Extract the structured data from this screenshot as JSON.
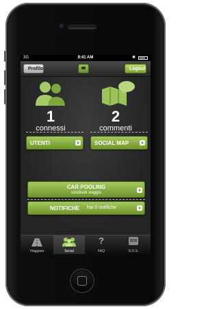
{
  "status_bar": {
    "carrier": "3G",
    "time": "9:41 AM"
  },
  "nav": {
    "left_button": "Profilo",
    "right_button": "Logout"
  },
  "stats": [
    {
      "value": "1",
      "label": "connessi",
      "button": "UTENTI"
    },
    {
      "value": "2",
      "label": "commenti",
      "button": "SOCIAL MAP"
    }
  ],
  "car_pooling": {
    "title": "CAR POOLING",
    "subtitle": "condividi viaggio"
  },
  "notifications": {
    "title": "NOTIFICHE",
    "text": "hai 0 notifiche"
  },
  "tabs": [
    {
      "label": "Viaggiare",
      "icon": "road-icon",
      "active": false
    },
    {
      "label": "Social",
      "icon": "people-icon",
      "active": true
    },
    {
      "label": "FAQ",
      "icon": "question-icon",
      "active": false
    },
    {
      "label": "S.O.S.",
      "icon": "sos-icon",
      "active": false
    }
  ],
  "colors": {
    "accent": "#8bb43f",
    "background": "#2a2a2a"
  }
}
